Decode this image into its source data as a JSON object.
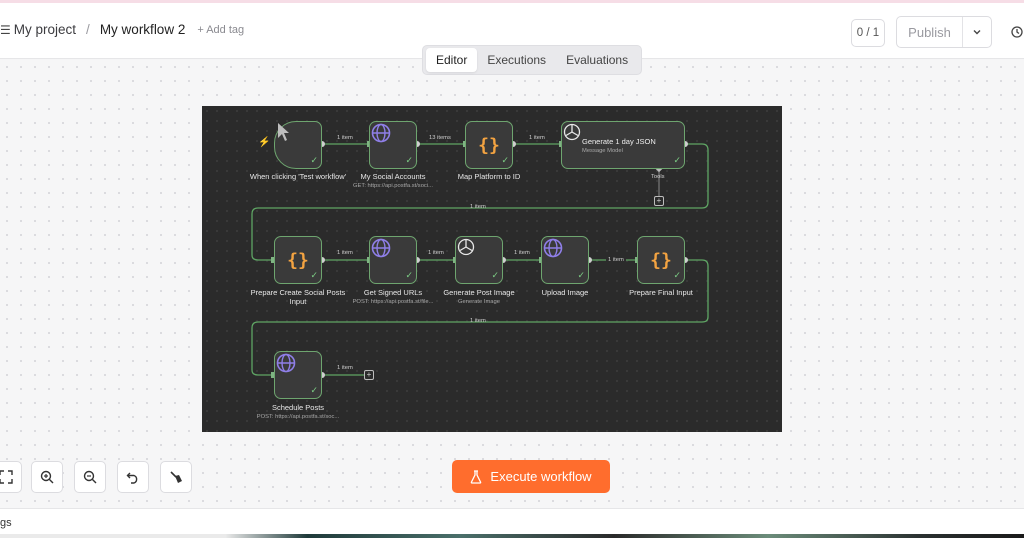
{
  "header": {
    "project": "My project",
    "separator": "/",
    "workflow_name": "My workflow 2",
    "add_tag": "+ Add tag",
    "version": "0 / 1",
    "publish": "Publish"
  },
  "tabs": [
    {
      "label": "Editor",
      "active": true
    },
    {
      "label": "Executions",
      "active": false
    },
    {
      "label": "Evaluations",
      "active": false
    }
  ],
  "workflow": {
    "nodes": [
      {
        "id": "trigger",
        "label": "When clicking 'Test workflow'",
        "sub": ""
      },
      {
        "id": "social",
        "label": "My Social Accounts",
        "sub": "GET: https://api.postfa.st/soci..."
      },
      {
        "id": "map",
        "label": "Map Platform to ID",
        "sub": ""
      },
      {
        "id": "generate",
        "title": "Generate 1 day JSON",
        "sub": "Message Model",
        "tools": "Tools"
      },
      {
        "id": "prepare",
        "label": "Prepare Create Social Posts Input",
        "sub": ""
      },
      {
        "id": "signed",
        "label": "Get Signed URLs",
        "sub": "POST: https://api.postfa.st/file..."
      },
      {
        "id": "genimage",
        "label": "Generate Post Image",
        "sub": "Generate Image"
      },
      {
        "id": "upload",
        "label": "Upload Image",
        "sub": ""
      },
      {
        "id": "final",
        "label": "Prepare Final Input",
        "sub": ""
      },
      {
        "id": "schedule",
        "label": "Schedule Posts",
        "sub": "POST: https://api.postfa.st/soc..."
      }
    ],
    "edges": {
      "e1": "1 item",
      "e2": "13 items",
      "e3": "1 item",
      "e4": "1 item",
      "e5": "1 item",
      "e6": "1 item",
      "e7": "1 item",
      "e8": "1 item",
      "e9": "1 item",
      "e10": "1 item"
    }
  },
  "controls": {
    "execute": "Execute workflow"
  },
  "bottom": {
    "logs": "gs"
  },
  "colors": {
    "accent": "#ff6d2d",
    "node_border": "#6ea56f",
    "canvas_dark": "#2b2b2b"
  }
}
